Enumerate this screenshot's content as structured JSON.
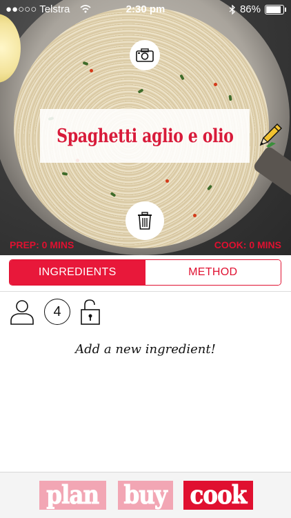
{
  "status_bar": {
    "carrier": "●●○○○ Telstra",
    "time": "2:30 pm",
    "battery": "86%"
  },
  "recipe": {
    "title": "Spaghetti aglio e olio",
    "prep": "PREP: 0 MINS",
    "cook": "COOK: 0 MINS"
  },
  "tabs": [
    {
      "label": "INGREDIENTS",
      "active": true
    },
    {
      "label": "METHOD",
      "active": false
    }
  ],
  "servings": {
    "count": "4"
  },
  "ingredients": {
    "empty_hint": "Add a new ingredient!"
  },
  "bottom_nav": {
    "plan": "plan",
    "buy": "buy",
    "cook": "cook"
  },
  "colors": {
    "accent": "#e01030",
    "accent_light": "#f2a6b4"
  },
  "icons": [
    "camera-icon",
    "trash-icon",
    "pencil-icon",
    "person-icon",
    "unlock-icon",
    "wifi-icon",
    "bluetooth-icon",
    "battery-icon"
  ]
}
